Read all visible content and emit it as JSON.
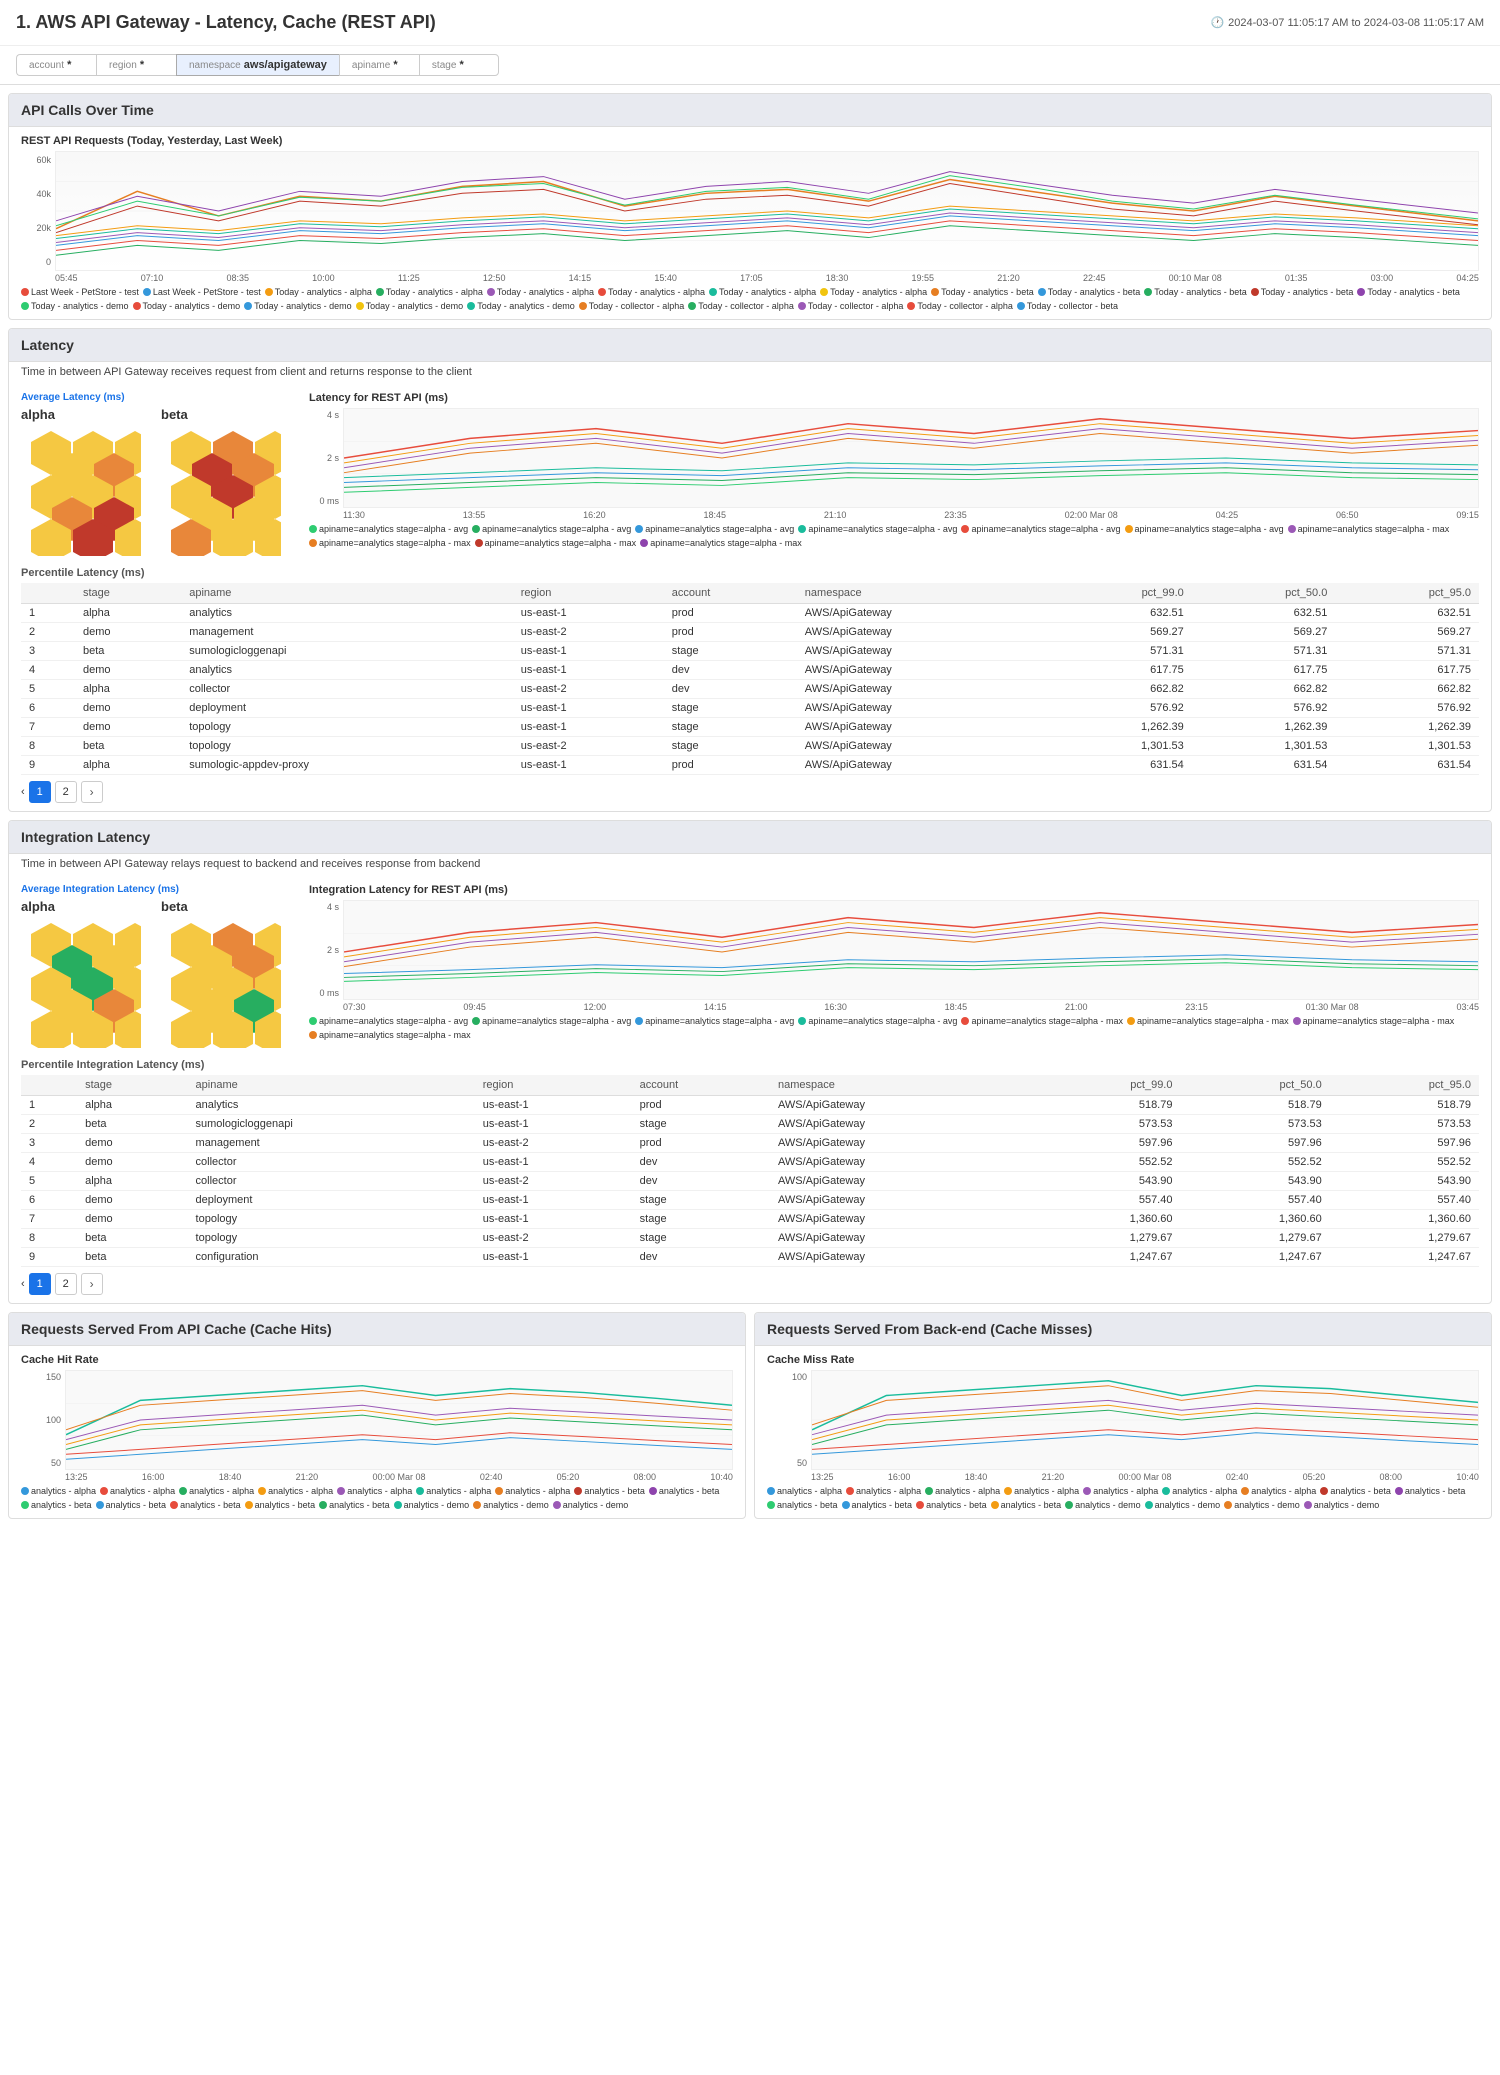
{
  "header": {
    "title": "1. AWS API Gateway - Latency, Cache (REST API)",
    "datetime": "2024-03-07 11:05:17 AM to 2024-03-08 11:05:17 AM",
    "clock_icon": "clock"
  },
  "filters": [
    {
      "label": "account",
      "value": "*",
      "id": "account"
    },
    {
      "label": "region",
      "value": "*",
      "id": "region"
    },
    {
      "label": "namespace",
      "value": "aws/apigateway",
      "id": "namespace"
    },
    {
      "label": "apiname",
      "value": "*",
      "id": "apiname"
    },
    {
      "label": "stage",
      "value": "*",
      "id": "stage"
    }
  ],
  "sections": {
    "api_calls": {
      "title": "API Calls Over Time",
      "chart_title": "REST API Requests (Today, Yesterday, Last Week)",
      "y_labels": [
        "60k",
        "40k",
        "20k",
        "0"
      ],
      "x_labels": [
        "05:45",
        "07:10",
        "08:35",
        "10:00",
        "11:25",
        "12:50",
        "14:15",
        "15:40",
        "17:05",
        "18:30",
        "19:55",
        "21:20",
        "22:45",
        "00:10 Mar 08",
        "01:35",
        "03:00",
        "04:25"
      ],
      "legend": [
        {
          "color": "#e74c3c",
          "label": "Last Week - PetStore - test"
        },
        {
          "color": "#3498db",
          "label": "Last Week - PetStore - test"
        },
        {
          "color": "#f39c12",
          "label": "Today - analytics - alpha"
        },
        {
          "color": "#27ae60",
          "label": "Today - analytics - alpha"
        },
        {
          "color": "#9b59b6",
          "label": "Today - analytics - alpha"
        },
        {
          "color": "#e74c3c",
          "label": "Today - analytics - alpha"
        },
        {
          "color": "#1abc9c",
          "label": "Today - analytics - alpha"
        },
        {
          "color": "#f39c12",
          "label": "Today - analytics - alpha"
        },
        {
          "color": "#e67e22",
          "label": "Today - analytics - beta"
        },
        {
          "color": "#3498db",
          "label": "Today - analytics - beta"
        },
        {
          "color": "#27ae60",
          "label": "Today - analytics - beta"
        },
        {
          "color": "#c0392b",
          "label": "Today - analytics - beta"
        },
        {
          "color": "#8e44ad",
          "label": "Today - analytics - beta"
        },
        {
          "color": "#2ecc71",
          "label": "Today - analytics - demo"
        },
        {
          "color": "#e74c3c",
          "label": "Today - analytics - demo"
        },
        {
          "color": "#3498db",
          "label": "Today - analytics - demo"
        },
        {
          "color": "#f1c40f",
          "label": "Today - analytics - demo"
        },
        {
          "color": "#1abc9c",
          "label": "Today - analytics - demo"
        },
        {
          "color": "#e67e22",
          "label": "Today - collector - alpha"
        },
        {
          "color": "#27ae60",
          "label": "Today - collector - alpha"
        },
        {
          "color": "#9b59b6",
          "label": "Today - collector - alpha"
        },
        {
          "color": "#e74c3c",
          "label": "Today - collector - alpha"
        },
        {
          "color": "#3498db",
          "label": "Today - collector - beta"
        }
      ]
    },
    "latency": {
      "title": "Latency",
      "description": "Time in between API Gateway receives request from client and returns response to the client",
      "avg_title": "Average Latency (ms)",
      "chart_title": "Latency for REST API (ms)",
      "alpha_label": "alpha",
      "beta_label": "beta",
      "chart_y_labels": [
        "4 s",
        "2 s",
        "0 ms"
      ],
      "chart_x_labels": [
        "11:30",
        "13:55",
        "16:20",
        "18:45",
        "21:10",
        "23:35",
        "02:00 Mar 08",
        "04:25",
        "06:50",
        "09:15"
      ],
      "chart_legend": [
        {
          "color": "#2ecc71",
          "label": "apiname=analytics stage=alpha - avg"
        },
        {
          "color": "#27ae60",
          "label": "apiname=analytics stage=alpha - avg"
        },
        {
          "color": "#3498db",
          "label": "apiname=analytics stage=alpha - avg"
        },
        {
          "color": "#1abc9c",
          "label": "apiname=analytics stage=alpha - avg"
        },
        {
          "color": "#e74c3c",
          "label": "apiname=analytics stage=alpha - avg"
        },
        {
          "color": "#f39c12",
          "label": "apiname=analytics stage=alpha - avg"
        },
        {
          "color": "#9b59b6",
          "label": "apiname=analytics stage=alpha - max"
        },
        {
          "color": "#e67e22",
          "label": "apiname=analytics stage=alpha - max"
        },
        {
          "color": "#c0392b",
          "label": "apiname=analytics stage=alpha - max"
        },
        {
          "color": "#8e44ad",
          "label": "apiname=analytics stage=alpha - max"
        }
      ],
      "table_title": "Percentile Latency (ms)",
      "table_headers": [
        "#",
        "stage",
        "apiname",
        "region",
        "account",
        "namespace",
        "pct_99.0",
        "pct_50.0",
        "pct_95.0"
      ],
      "table_rows": [
        {
          "num": 1,
          "stage": "alpha",
          "apiname": "analytics",
          "region": "us-east-1",
          "account": "prod",
          "namespace": "AWS/ApiGateway",
          "p99": "632.51",
          "p50": "632.51",
          "p95": "632.51"
        },
        {
          "num": 2,
          "stage": "demo",
          "apiname": "management",
          "region": "us-east-2",
          "account": "prod",
          "namespace": "AWS/ApiGateway",
          "p99": "569.27",
          "p50": "569.27",
          "p95": "569.27"
        },
        {
          "num": 3,
          "stage": "beta",
          "apiname": "sumologicloggenapi",
          "region": "us-east-1",
          "account": "stage",
          "namespace": "AWS/ApiGateway",
          "p99": "571.31",
          "p50": "571.31",
          "p95": "571.31"
        },
        {
          "num": 4,
          "stage": "demo",
          "apiname": "analytics",
          "region": "us-east-1",
          "account": "dev",
          "namespace": "AWS/ApiGateway",
          "p99": "617.75",
          "p50": "617.75",
          "p95": "617.75"
        },
        {
          "num": 5,
          "stage": "alpha",
          "apiname": "collector",
          "region": "us-east-2",
          "account": "dev",
          "namespace": "AWS/ApiGateway",
          "p99": "662.82",
          "p50": "662.82",
          "p95": "662.82"
        },
        {
          "num": 6,
          "stage": "demo",
          "apiname": "deployment",
          "region": "us-east-1",
          "account": "stage",
          "namespace": "AWS/ApiGateway",
          "p99": "576.92",
          "p50": "576.92",
          "p95": "576.92"
        },
        {
          "num": 7,
          "stage": "demo",
          "apiname": "topology",
          "region": "us-east-1",
          "account": "stage",
          "namespace": "AWS/ApiGateway",
          "p99": "1,262.39",
          "p50": "1,262.39",
          "p95": "1,262.39"
        },
        {
          "num": 8,
          "stage": "beta",
          "apiname": "topology",
          "region": "us-east-2",
          "account": "stage",
          "namespace": "AWS/ApiGateway",
          "p99": "1,301.53",
          "p50": "1,301.53",
          "p95": "1,301.53"
        },
        {
          "num": 9,
          "stage": "alpha",
          "apiname": "sumologic-appdev-proxy",
          "region": "us-east-1",
          "account": "prod",
          "namespace": "AWS/ApiGateway",
          "p99": "631.54",
          "p50": "631.54",
          "p95": "631.54"
        }
      ],
      "pagination": {
        "current": 1,
        "total": 2
      }
    },
    "integration_latency": {
      "title": "Integration Latency",
      "description": "Time in between API Gateway relays request to backend and receives response from backend",
      "avg_title": "Average Integration Latency (ms)",
      "chart_title": "Integration Latency for REST API (ms)",
      "alpha_label": "alpha",
      "beta_label": "beta",
      "chart_y_labels": [
        "4 s",
        "2 s",
        "0 ms"
      ],
      "chart_x_labels": [
        "07:30",
        "09:45",
        "12:00",
        "14:15",
        "16:30",
        "18:45",
        "21:00",
        "23:15",
        "01:30 Mar 08",
        "03:45"
      ],
      "chart_legend": [
        {
          "color": "#2ecc71",
          "label": "apiname=analytics stage=alpha - avg"
        },
        {
          "color": "#27ae60",
          "label": "apiname=analytics stage=alpha - avg"
        },
        {
          "color": "#3498db",
          "label": "apiname=analytics stage=alpha - avg"
        },
        {
          "color": "#1abc9c",
          "label": "apiname=analytics stage=alpha - avg"
        },
        {
          "color": "#e74c3c",
          "label": "apiname=analytics stage=alpha - max"
        },
        {
          "color": "#f39c12",
          "label": "apiname=analytics stage=alpha - max"
        },
        {
          "color": "#9b59b6",
          "label": "apiname=analytics stage=alpha - max"
        },
        {
          "color": "#e67e22",
          "label": "apiname=analytics stage=alpha - max"
        }
      ],
      "table_title": "Percentile Integration Latency (ms)",
      "table_headers": [
        "#",
        "stage",
        "apiname",
        "region",
        "account",
        "namespace",
        "pct_99.0",
        "pct_50.0",
        "pct_95.0"
      ],
      "table_rows": [
        {
          "num": 1,
          "stage": "alpha",
          "apiname": "analytics",
          "region": "us-east-1",
          "account": "prod",
          "namespace": "AWS/ApiGateway",
          "p99": "518.79",
          "p50": "518.79",
          "p95": "518.79"
        },
        {
          "num": 2,
          "stage": "beta",
          "apiname": "sumologicloggenapi",
          "region": "us-east-1",
          "account": "stage",
          "namespace": "AWS/ApiGateway",
          "p99": "573.53",
          "p50": "573.53",
          "p95": "573.53"
        },
        {
          "num": 3,
          "stage": "demo",
          "apiname": "management",
          "region": "us-east-2",
          "account": "prod",
          "namespace": "AWS/ApiGateway",
          "p99": "597.96",
          "p50": "597.96",
          "p95": "597.96"
        },
        {
          "num": 4,
          "stage": "demo",
          "apiname": "collector",
          "region": "us-east-1",
          "account": "dev",
          "namespace": "AWS/ApiGateway",
          "p99": "552.52",
          "p50": "552.52",
          "p95": "552.52"
        },
        {
          "num": 5,
          "stage": "alpha",
          "apiname": "collector",
          "region": "us-east-2",
          "account": "dev",
          "namespace": "AWS/ApiGateway",
          "p99": "543.90",
          "p50": "543.90",
          "p95": "543.90"
        },
        {
          "num": 6,
          "stage": "demo",
          "apiname": "deployment",
          "region": "us-east-1",
          "account": "stage",
          "namespace": "AWS/ApiGateway",
          "p99": "557.40",
          "p50": "557.40",
          "p95": "557.40"
        },
        {
          "num": 7,
          "stage": "demo",
          "apiname": "topology",
          "region": "us-east-1",
          "account": "stage",
          "namespace": "AWS/ApiGateway",
          "p99": "1,360.60",
          "p50": "1,360.60",
          "p95": "1,360.60"
        },
        {
          "num": 8,
          "stage": "beta",
          "apiname": "topology",
          "region": "us-east-2",
          "account": "stage",
          "namespace": "AWS/ApiGateway",
          "p99": "1,279.67",
          "p50": "1,279.67",
          "p95": "1,279.67"
        },
        {
          "num": 9,
          "stage": "beta",
          "apiname": "configuration",
          "region": "us-east-1",
          "account": "dev",
          "namespace": "AWS/ApiGateway",
          "p99": "1,247.67",
          "p50": "1,247.67",
          "p95": "1,247.67"
        }
      ],
      "pagination": {
        "current": 1,
        "total": 2
      }
    },
    "cache_hits": {
      "title": "Requests Served From API Cache (Cache Hits)",
      "chart_title": "Cache Hit Rate",
      "y_labels": [
        "150",
        "100",
        "50"
      ],
      "x_labels": [
        "13:25",
        "16:00",
        "18:40",
        "21:20",
        "00:00 Mar 08",
        "02:40",
        "05:20",
        "08:00",
        "10:40"
      ],
      "legend": [
        {
          "color": "#3498db",
          "label": "analytics - alpha"
        },
        {
          "color": "#e74c3c",
          "label": "analytics - alpha"
        },
        {
          "color": "#27ae60",
          "label": "analytics - alpha"
        },
        {
          "color": "#f39c12",
          "label": "analytics - alpha"
        },
        {
          "color": "#9b59b6",
          "label": "analytics - alpha"
        },
        {
          "color": "#1abc9c",
          "label": "analytics - alpha"
        },
        {
          "color": "#e67e22",
          "label": "analytics - alpha"
        },
        {
          "color": "#c0392b",
          "label": "analytics - beta"
        },
        {
          "color": "#8e44ad",
          "label": "analytics - beta"
        },
        {
          "color": "#2ecc71",
          "label": "analytics - beta"
        },
        {
          "color": "#3498db",
          "label": "analytics - beta"
        },
        {
          "color": "#e74c3c",
          "label": "analytics - beta"
        },
        {
          "color": "#f39c12",
          "label": "analytics - beta"
        },
        {
          "color": "#27ae60",
          "label": "analytics - beta"
        },
        {
          "color": "#1abc9c",
          "label": "analytics - demo"
        },
        {
          "color": "#e67e22",
          "label": "analytics - demo"
        },
        {
          "color": "#9b59b6",
          "label": "analytics - demo"
        }
      ]
    },
    "cache_misses": {
      "title": "Requests Served From Back-end (Cache Misses)",
      "chart_title": "Cache Miss Rate",
      "y_labels": [
        "100",
        "50"
      ],
      "x_labels": [
        "13:25",
        "16:00",
        "18:40",
        "21:20",
        "00:00 Mar 08",
        "02:40",
        "05:20",
        "08:00",
        "10:40"
      ],
      "legend": [
        {
          "color": "#3498db",
          "label": "analytics - alpha"
        },
        {
          "color": "#e74c3c",
          "label": "analytics - alpha"
        },
        {
          "color": "#27ae60",
          "label": "analytics - alpha"
        },
        {
          "color": "#f39c12",
          "label": "analytics - alpha"
        },
        {
          "color": "#9b59b6",
          "label": "analytics - alpha"
        },
        {
          "color": "#1abc9c",
          "label": "analytics - alpha"
        },
        {
          "color": "#e67e22",
          "label": "analytics - alpha"
        },
        {
          "color": "#c0392b",
          "label": "analytics - beta"
        },
        {
          "color": "#8e44ad",
          "label": "analytics - beta"
        },
        {
          "color": "#2ecc71",
          "label": "analytics - beta"
        },
        {
          "color": "#3498db",
          "label": "analytics - beta"
        },
        {
          "color": "#e74c3c",
          "label": "analytics - beta"
        },
        {
          "color": "#f39c12",
          "label": "analytics - beta"
        },
        {
          "color": "#27ae60",
          "label": "analytics - demo"
        },
        {
          "color": "#1abc9c",
          "label": "analytics - demo"
        },
        {
          "color": "#e67e22",
          "label": "analytics - demo"
        },
        {
          "color": "#9b59b6",
          "label": "analytics - demo"
        }
      ]
    }
  }
}
